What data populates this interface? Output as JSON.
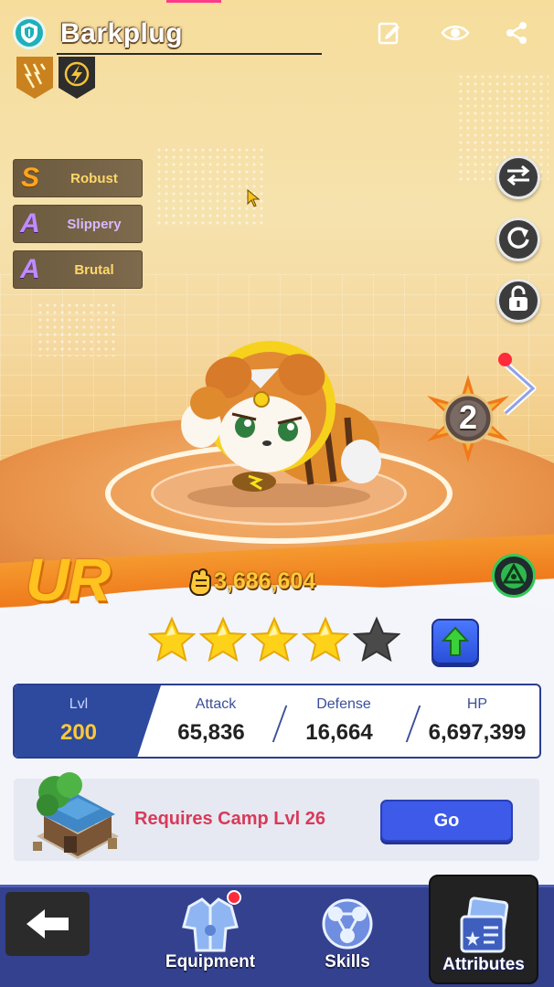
{
  "header": {
    "name": "Barkplug",
    "icons": [
      "shield-logo-icon",
      "edit-icon",
      "eye-icon",
      "share-icon"
    ]
  },
  "type_badges": [
    "electric-claw-icon",
    "lightning-icon"
  ],
  "traits": [
    {
      "grade": "S",
      "label": "Robust"
    },
    {
      "grade": "A",
      "label": "Slippery"
    },
    {
      "grade": "A",
      "label": "Brutal"
    }
  ],
  "side_buttons": [
    "swap-icon",
    "refresh-icon",
    "lock-icon"
  ],
  "rank": {
    "value": "2"
  },
  "rarity": "UR",
  "power": "3,686,604",
  "stars": {
    "filled": 4,
    "total": 5
  },
  "stats": {
    "lvl_label": "Lvl",
    "lvl_value": "200",
    "attack_label": "Attack",
    "attack_value": "65,836",
    "defense_label": "Defense",
    "defense_value": "16,664",
    "hp_label": "HP",
    "hp_value": "6,697,399"
  },
  "requirement": {
    "text": "Requires Camp Lvl 26",
    "button": "Go"
  },
  "nav": {
    "equipment": "Equipment",
    "skills": "Skills",
    "attributes": "Attributes"
  },
  "colors": {
    "accent_blue": "#3d5ae8",
    "stat_blue": "#2e4a9e",
    "requirement_red": "#d83a5a",
    "gold": "#ffc21f"
  }
}
